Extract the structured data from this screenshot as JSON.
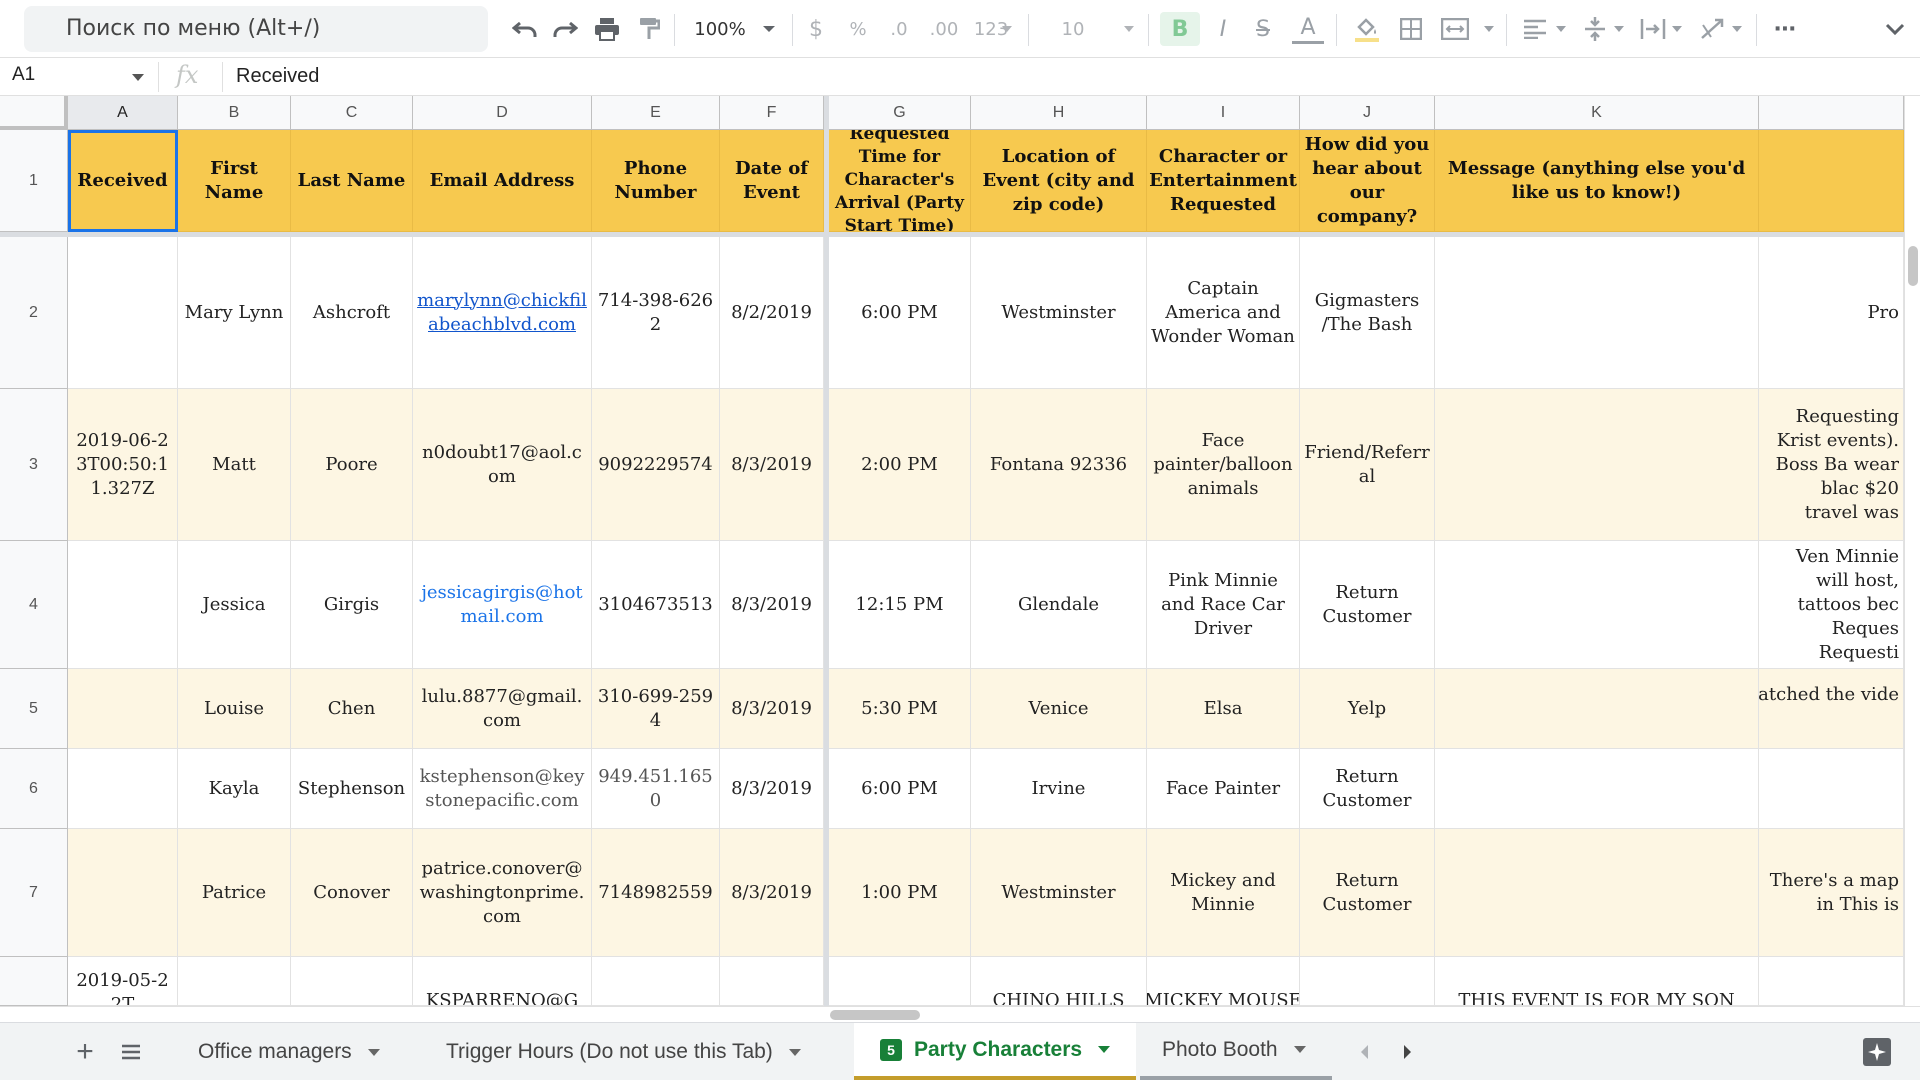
{
  "toolbar": {
    "search_placeholder": "Поиск по меню (Alt+/)",
    "zoom": "100%",
    "currency": "$",
    "percent": "%",
    "decrease_decimals": ".0",
    "increase_decimals": ".00",
    "number_format": "123",
    "font_size": "10",
    "bold": "B",
    "italic": "I",
    "strike": "S",
    "text_color": "A",
    "more": "⋯"
  },
  "formula_bar": {
    "cell_ref": "A1",
    "fx": "fx",
    "content": "Received"
  },
  "columns": [
    "A",
    "B",
    "C",
    "D",
    "E",
    "F",
    "G",
    "H",
    "I",
    "J",
    "K"
  ],
  "rows": [
    "1",
    "2",
    "3",
    "4",
    "5",
    "6",
    "7"
  ],
  "header_cells": {
    "A": "Received",
    "B": "First Name",
    "C": "Last Name",
    "D": "Email Address",
    "E": "Phone Number",
    "F": "Date of Event",
    "G": "Requested Time for Character's Arrival (Party Start Time)",
    "H": "Location of Event (city and zip code)",
    "I": "Character or Entertainment Requested",
    "J": "How did you hear about our company?",
    "K": "Message (anything else you'd like us to know!)"
  },
  "data_rows": [
    {
      "A": "",
      "B": "Mary Lynn",
      "C": "Ashcroft",
      "D": "marylynn@chickfilabeachblvd.com",
      "E": "714-398-6262",
      "F": "8/2/2019",
      "G": "6:00 PM",
      "H": "Westminster",
      "I": "Captain America and Wonder Woman",
      "J": "Gigmasters /The Bash",
      "K": "",
      "L": "Pro"
    },
    {
      "A": "2019-06-23T00:50:11.327Z",
      "B": "Matt",
      "C": "Poore",
      "D": "n0doubt17@aol.com",
      "E": "9092229574",
      "F": "8/3/2019",
      "G": "2:00 PM",
      "H": "Fontana 92336",
      "I": "Face painter/balloon animals",
      "J": "Friend/Referral",
      "K": "",
      "L": "Requesting Krist events). Boss Ba wear blac $20 travel was"
    },
    {
      "A": "",
      "B": "Jessica",
      "C": "Girgis",
      "D": "jessicagirgis@hotmail.com",
      "E": "3104673513",
      "F": "8/3/2019",
      "G": "12:15 PM",
      "H": "Glendale",
      "I": "Pink Minnie and Race Car Driver",
      "J": "Return Customer",
      "K": "",
      "L": "Ven Minnie will host, tattoos bec Reques Requesti"
    },
    {
      "A": "",
      "B": "Louise",
      "C": "Chen",
      "D": "lulu.8877@gmail.com",
      "E": "310-699-2594",
      "F": "8/3/2019",
      "G": "5:30 PM",
      "H": "Venice",
      "I": "Elsa",
      "J": "Yelp",
      "K": "",
      "L": "watched the vide"
    },
    {
      "A": "",
      "B": "Kayla",
      "C": "Stephenson",
      "D": "kstephenson@keystonepacific.com",
      "E": "949.451.1650",
      "F": "8/3/2019",
      "G": "6:00 PM",
      "H": "Irvine",
      "I": "Face Painter",
      "J": "Return Customer",
      "K": "",
      "L": ""
    },
    {
      "A": "",
      "B": "Patrice",
      "C": "Conover",
      "D": "patrice.conover@washingtonprime.com",
      "E": "7148982559",
      "F": "8/3/2019",
      "G": "1:00 PM",
      "H": "Westminster",
      "I": "Mickey and Minnie",
      "J": "Return Customer",
      "K": "",
      "L": "There's a map in This is"
    },
    {
      "A": "2019-05-22T",
      "B": "",
      "C": "",
      "D": "KSPARRENO@GM",
      "E": "",
      "F": "",
      "G": "",
      "H": "CHINO HILLS",
      "I": "MICKEY MOUSE",
      "J": "",
      "K": "THIS EVENT IS FOR MY SON",
      "L": ""
    }
  ],
  "sheet_tabs": [
    {
      "label": "Office managers",
      "active": false
    },
    {
      "label": "Trigger Hours (Do not use this Tab)",
      "active": false
    },
    {
      "label": "Party Characters",
      "active": true,
      "badge": "5"
    },
    {
      "label": "Photo Booth",
      "active": false
    }
  ],
  "colors": {
    "header_fill": "#f7c94f",
    "band_fill": "#fdf6e3",
    "selection": "#1a73e8",
    "active_tab_text": "#188038"
  }
}
